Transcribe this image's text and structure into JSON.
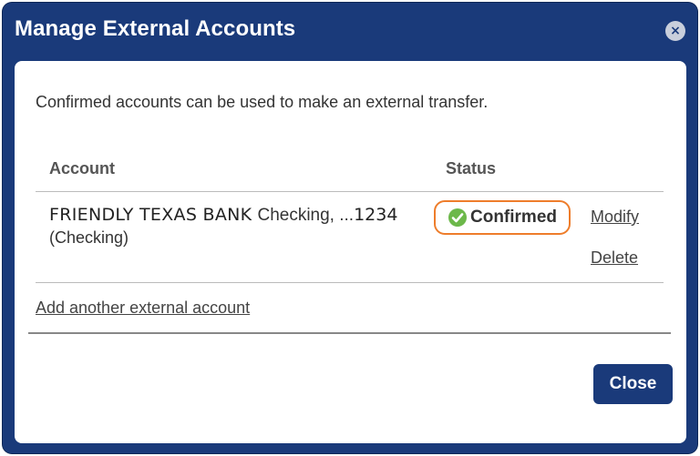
{
  "dialog": {
    "title": "Manage External Accounts",
    "close_icon_glyph": "×",
    "intro_text": "Confirmed accounts can be used to make an external transfer.",
    "columns": {
      "account": "Account",
      "status": "Status"
    },
    "accounts": [
      {
        "bank_name": "FRIENDLY TEXAS BANK",
        "account_type": "Checking, ...",
        "account_number": "1234",
        "account_kind": "(Checking)",
        "status": "Confirmed",
        "status_icon": "check-circle-icon",
        "modify_label": "Modify",
        "delete_label": "Delete"
      }
    ],
    "add_link_label": "Add another external account",
    "close_button_label": "Close"
  },
  "colors": {
    "header_bg": "#1a3a7a",
    "status_border": "#ee7d2b",
    "confirmed_green": "#6cb84a"
  }
}
